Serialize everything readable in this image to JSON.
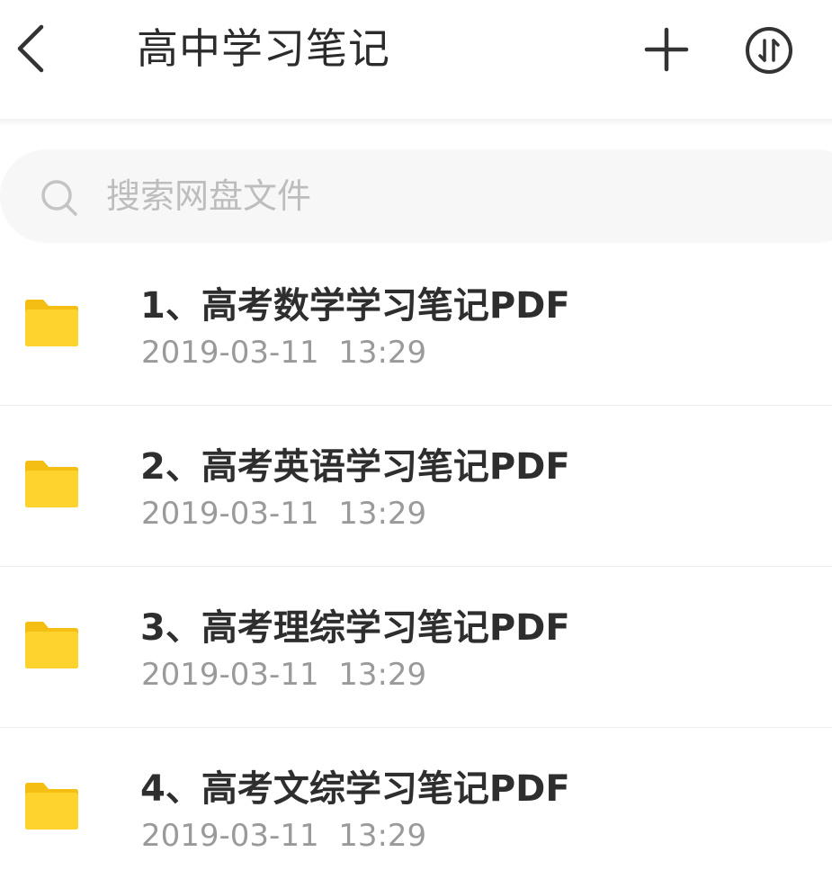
{
  "header": {
    "title": "高中学习笔记",
    "back_icon": "chevron-left-icon",
    "add_icon": "plus-icon",
    "sort_icon": "sort-icon"
  },
  "search": {
    "placeholder": "搜索网盘文件",
    "icon": "search-icon"
  },
  "folders": [
    {
      "name": "1、高考数学学习笔记PDF",
      "modified": "2019-03-11  13:29"
    },
    {
      "name": "2、高考英语学习笔记PDF",
      "modified": "2019-03-11  13:29"
    },
    {
      "name": "3、高考理综学习笔记PDF",
      "modified": "2019-03-11  13:29"
    },
    {
      "name": "4、高考文综学习笔记PDF",
      "modified": "2019-03-11  13:29"
    }
  ],
  "colors": {
    "folder": "#FFD32E",
    "folder_tab": "#F4BE12",
    "title_text": "#2B2B2B",
    "date_text": "#9A9A9A",
    "placeholder_text": "#BDBDBD",
    "search_bg": "#F7F7F7"
  }
}
